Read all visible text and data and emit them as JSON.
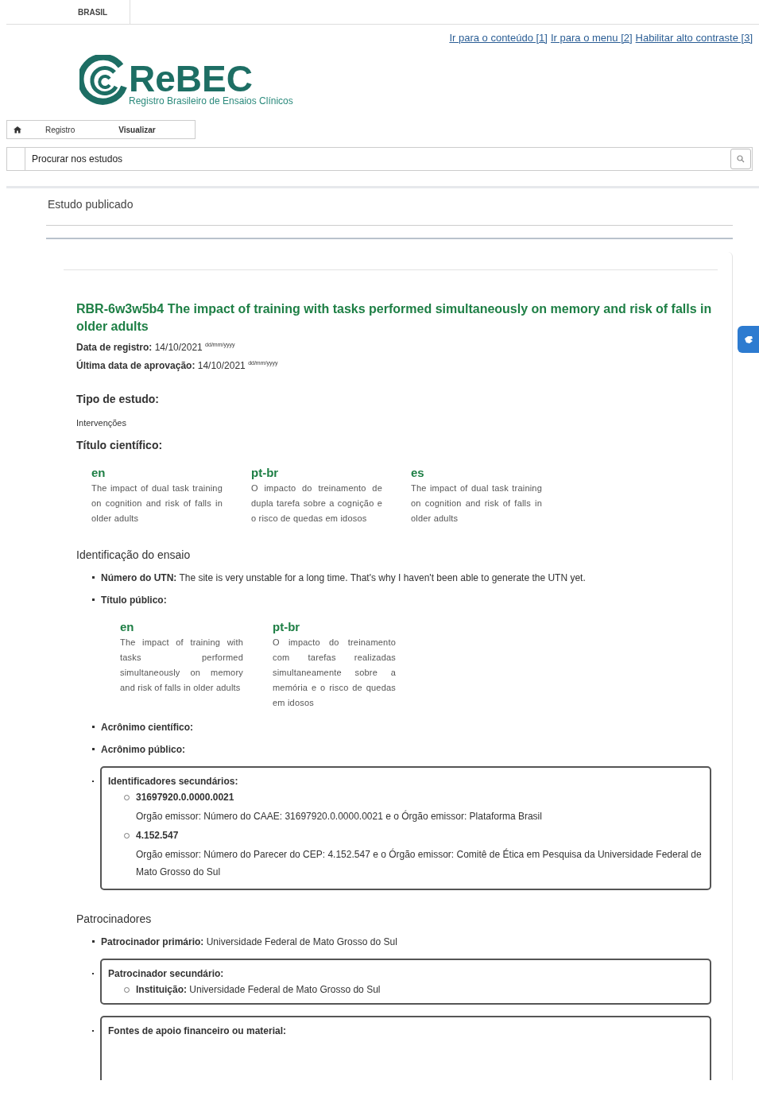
{
  "gov_bar": {
    "label": "BRASIL"
  },
  "accessibility_links": [
    "Ir para o conteúdo [1]",
    "Ir para o menu [2]",
    "Habilitar alto contraste [3]"
  ],
  "logo": {
    "name": "ReBEC",
    "subtitle": "Registro Brasileiro de Ensaios Clínicos"
  },
  "breadcrumb": [
    {
      "label": "Registro"
    },
    {
      "label": "Visualizar"
    }
  ],
  "search": {
    "placeholder": "Procurar nos estudos"
  },
  "page_heading": "Estudo publicado",
  "study": {
    "title": "RBR-6w3w5b4 The impact of training with tasks performed simultaneously on memory and risk of falls in older adults",
    "dates": [
      {
        "label": "Data de registro:",
        "value": "14/10/2021",
        "hint": "dd/mm/yyyy"
      },
      {
        "label": "Última data de aprovação:",
        "value": "14/10/2021",
        "hint": "dd/mm/yyyy"
      }
    ],
    "content": [
      {
        "kind": "subheading",
        "text": "Tipo de estudo:"
      },
      {
        "kind": "paragraph",
        "text": "Intervenções"
      },
      {
        "kind": "subheading",
        "text": "Título científico:"
      },
      {
        "kind": "translations",
        "columns": [
          {
            "lang": "en",
            "text": "The impact of dual task training on cognition and risk of falls in older adults"
          },
          {
            "lang": "pt-br",
            "text": "O impacto do treinamento de dupla tarefa sobre a cognição e o risco de quedas em idosos"
          },
          {
            "lang": "es",
            "text": "The impact of dual task training on cognition and risk of falls in older adults"
          }
        ]
      },
      {
        "kind": "heading",
        "text": "Identificação do ensaio"
      },
      {
        "kind": "bullet",
        "label": "Número do UTN:",
        "value": "The site is very unstable for a long time. That's why I haven't been able to generate the UTN yet."
      },
      {
        "kind": "bullet",
        "label": "Título público:",
        "translations": [
          {
            "lang": "en",
            "text": "The impact of training with tasks performed simultaneously on memory and risk of falls in older adults"
          },
          {
            "lang": "pt-br",
            "text": "O impacto do treinamento com tarefas realizadas simultaneamente sobre a memória e o risco de quedas em idosos"
          }
        ]
      },
      {
        "kind": "bullet",
        "label": "Acrônimo científico:"
      },
      {
        "kind": "bullet",
        "label": "Acrônimo público:"
      },
      {
        "kind": "box",
        "label": "Identificadores secundários:",
        "items": [
          {
            "label": "31697920.0.0000.0021",
            "detail": "Orgão emissor: Número do CAAE: 31697920.0.0000.0021 e o Órgão emissor: Plataforma Brasil"
          },
          {
            "label": "4.152.547",
            "detail": "Orgão emissor: Número do Parecer do CEP: 4.152.547 e o Órgão emissor: Comitê de Ética em Pesquisa da Universidade Federal de Mato Grosso do Sul"
          }
        ]
      },
      {
        "kind": "heading",
        "text": "Patrocinadores"
      },
      {
        "kind": "bullet",
        "label": "Patrocinador primário:",
        "value": "Universidade Federal de Mato Grosso do Sul"
      },
      {
        "kind": "box",
        "label": "Patrocinador secundário:",
        "items": [
          {
            "label": "Instituição:",
            "value": "Universidade Federal de Mato Grosso do Sul"
          }
        ]
      },
      {
        "kind": "box",
        "label": "Fontes de apoio financeiro ou material:",
        "open_end": true
      }
    ]
  }
}
